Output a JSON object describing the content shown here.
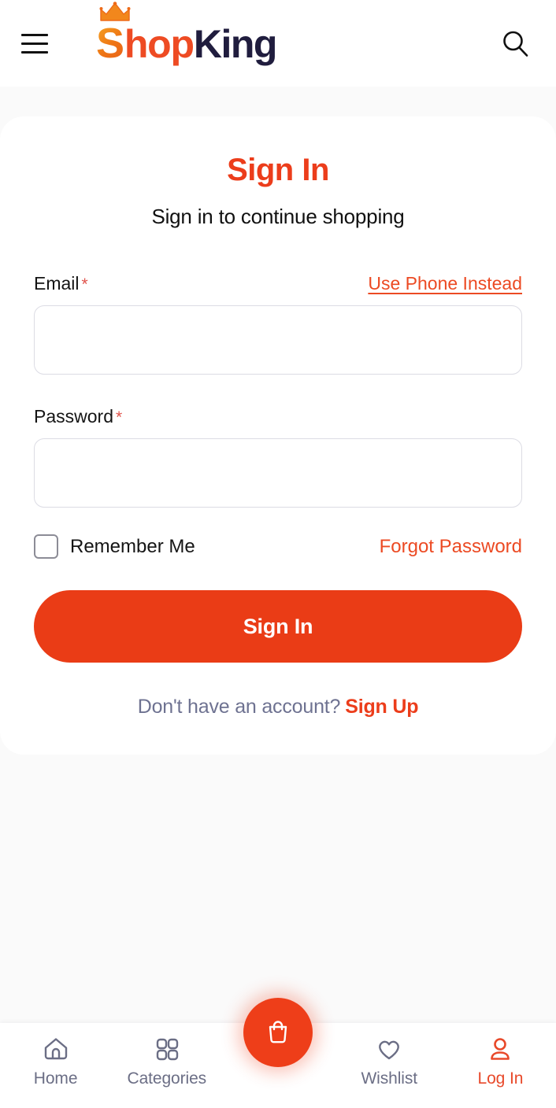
{
  "header": {
    "menu_icon": "hamburger-menu-icon",
    "search_icon": "search-icon",
    "logo": {
      "part_s": "S",
      "part_hop": "hop",
      "part_king": "King",
      "crown_icon": "crown-icon",
      "color_s": "#F0811A",
      "color_hop": "#EE4B23",
      "color_king": "#201D3E"
    }
  },
  "auth": {
    "title": "Sign In",
    "subtitle": "Sign in to continue shopping",
    "email": {
      "label": "Email",
      "required_mark": "*",
      "value": "",
      "placeholder": "",
      "alt_link": "Use Phone Instead"
    },
    "password": {
      "label": "Password",
      "required_mark": "*",
      "value": "",
      "placeholder": ""
    },
    "remember_me": {
      "label": "Remember Me",
      "checked": false
    },
    "forgot_password": "Forgot Password",
    "submit_label": "Sign In",
    "signup_prompt": "Don't have an account?",
    "signup_link": "Sign Up"
  },
  "bottom_nav": {
    "items": [
      {
        "label": "Home",
        "icon": "home-icon",
        "active": false
      },
      {
        "label": "Categories",
        "icon": "grid-icon",
        "active": false
      },
      {
        "label": "Wishlist",
        "icon": "heart-icon",
        "active": false
      },
      {
        "label": "Log In",
        "icon": "user-icon",
        "active": true
      }
    ],
    "fab": {
      "icon": "shopping-bag-icon"
    }
  },
  "colors": {
    "accent": "#EC3D1B",
    "button": "#EA3C16",
    "nav_inactive": "#6B6E85",
    "nav_active": "#E8492A",
    "muted_text": "#6E7291",
    "page_bg": "#FAFAFA",
    "border": "#DCDCE4"
  }
}
